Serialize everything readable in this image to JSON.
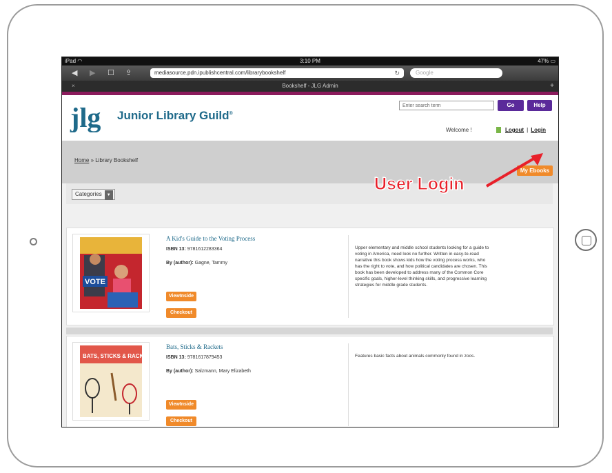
{
  "status_bar": {
    "device": "iPad",
    "time": "3:10 PM",
    "battery": "47%"
  },
  "browser": {
    "url": "mediasource.pdn.ipublishcentral.com/librarybookshelf",
    "search_placeholder": "Google",
    "tab_title": "Bookshelf - JLG Admin"
  },
  "header": {
    "brand": "Junior Library Guild",
    "search_placeholder": "Enter search term",
    "go_label": "Go",
    "help_label": "Help",
    "welcome": "Welcome !",
    "logout": "Logout",
    "login": "Login"
  },
  "breadcrumb": {
    "home": "Home",
    "sep": "»",
    "current": "Library Bookshelf"
  },
  "my_ebooks": "My Ebooks",
  "categories_label": "Categories",
  "books": [
    {
      "title": "A Kid's Guide to the Voting Process",
      "isbn_label": "ISBN 13:",
      "isbn": "9781612283364",
      "author_label": "By (author):",
      "author": "Gagne, Tammy",
      "viewinside": "ViewInside",
      "checkout": "Checkout",
      "description": "Upper elementary and middle school students looking for a guide to voting in America, need look no further. Written in easy-to-read narrative this book shows kids how the voting process works, who has the right to vote, and how political candidates are chosen. This book has been developed to address many of the Common Core specific goals, higher-level thinking skills, and progressive learning strategies for middle grade students."
    },
    {
      "title": "Bats, Sticks & Rackets",
      "isbn_label": "ISBN 13:",
      "isbn": "9781617879453",
      "author_label": "By (author):",
      "author": "Salzmann, Mary Elizabeth",
      "viewinside": "ViewInside",
      "checkout": "Checkout",
      "description": "Features basic facts about animals commonly found in zoos."
    }
  ],
  "annotation": "User Login",
  "colors": {
    "accent_bar": "#8b1b5c",
    "brand": "#1f6a8a",
    "button_purple": "#5a2a9a",
    "button_orange": "#f08a2a",
    "annotation": "#e8202a"
  }
}
